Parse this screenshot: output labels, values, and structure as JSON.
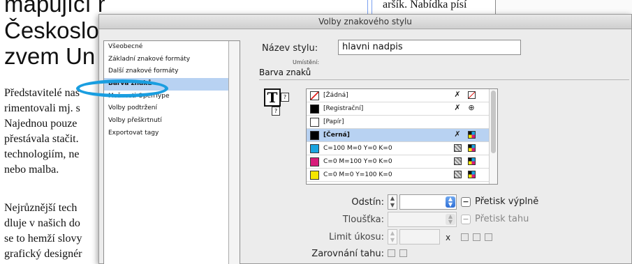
{
  "document": {
    "heading_lines": [
      "mapující meziválečné umění v",
      "Českoslo",
      "zvem Un"
    ],
    "body_lines": [
      "Představitelé nas",
      "rimentovali mj. s",
      "Najednou pouze",
      "přestávala stačit.",
      "technologiím, ne",
      "nebo malba.",
      "",
      "Nejrůznější tech",
      "dluje v našich do",
      "se to hemží slovy",
      "grafický designér"
    ],
    "right_column_text": "aršík. Nabídka písí"
  },
  "dialog": {
    "title": "Volby znakového stylu",
    "categories": [
      {
        "label": "Všeobecné",
        "selected": false
      },
      {
        "label": "Základní znakové formáty",
        "selected": false
      },
      {
        "label": "Další znakové formáty",
        "selected": false
      },
      {
        "label": "Barva znaků",
        "selected": true
      },
      {
        "label": "Možnosti OpenType",
        "selected": false
      },
      {
        "label": "Volby podtržení",
        "selected": false
      },
      {
        "label": "Volby přeškrtnutí",
        "selected": false
      },
      {
        "label": "Exportovat tagy",
        "selected": false
      }
    ],
    "style_name_label": "Název stylu:",
    "style_name_value": "hlavni nadpis",
    "location_label": "Umístění:",
    "section_title": "Barva znaků",
    "char_icon_glyph": "T",
    "char_icon_question": "?",
    "swatches": [
      {
        "name": "[Žádná]",
        "color": "#ffffff",
        "none": true,
        "selected": false,
        "icon1": "✗",
        "icon2": "none"
      },
      {
        "name": "[Registrační]",
        "color": "#000000",
        "none": false,
        "selected": false,
        "icon1": "✗",
        "icon2": "⊕"
      },
      {
        "name": "[Papír]",
        "color": "#ffffff",
        "none": false,
        "selected": false,
        "icon1": "",
        "icon2": ""
      },
      {
        "name": "[Černá]",
        "color": "#000000",
        "none": false,
        "selected": true,
        "icon1": "✗",
        "icon2": "cmyk"
      },
      {
        "name": "C=100 M=0 Y=0 K=0",
        "color": "#19a4e0",
        "none": false,
        "selected": false,
        "icon1": "gray",
        "icon2": "cmyk"
      },
      {
        "name": "C=0 M=100 Y=0 K=0",
        "color": "#d81b7a",
        "none": false,
        "selected": false,
        "icon1": "gray",
        "icon2": "cmyk"
      },
      {
        "name": "C=0 M=0 Y=100 K=0",
        "color": "#f5e600",
        "none": false,
        "selected": false,
        "icon1": "gray",
        "icon2": "cmyk"
      }
    ],
    "tint_label": "Odstín:",
    "tint_value": "",
    "overprint_fill_label": "Přetisk výplně",
    "weight_label": "Tloušťka:",
    "overprint_stroke_label": "Přetisk tahu",
    "miter_limit_label": "Limit úkosu:",
    "miter_x": "x",
    "stroke_align_label": "Zarovnání tahu:",
    "check_symbol": "−"
  },
  "colors": {
    "accent_highlight": "#1a9ee0",
    "selection": "#b8d2f2"
  }
}
